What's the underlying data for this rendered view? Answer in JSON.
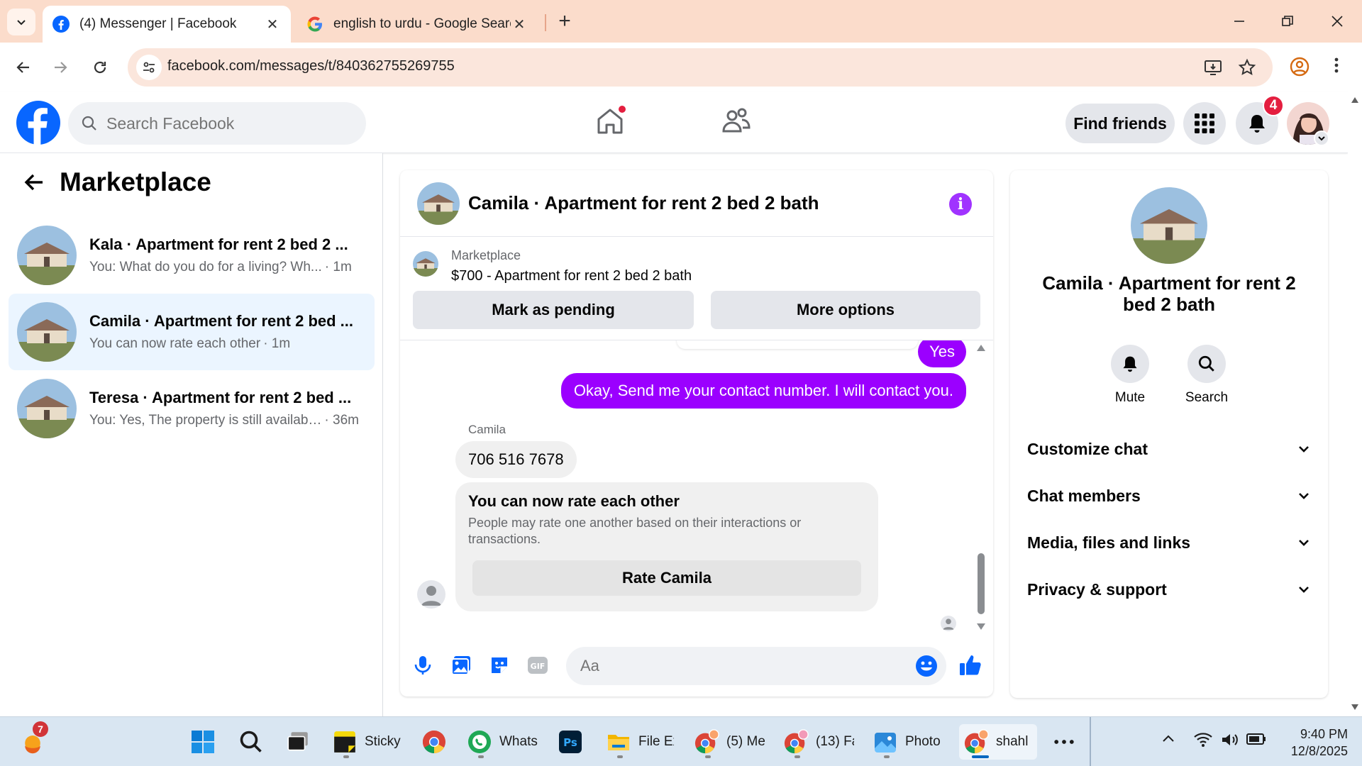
{
  "browser": {
    "tabs": [
      {
        "title": "(4) Messenger | Facebook",
        "icon": "facebook-icon",
        "active": true
      },
      {
        "title": "english to urdu - Google Search",
        "icon": "google-icon",
        "active": false
      }
    ],
    "url": "facebook.com/messages/t/840362755269755"
  },
  "header": {
    "search_placeholder": "Search Facebook",
    "find_friends": "Find friends",
    "notification_count": "4"
  },
  "sidebar": {
    "title": "Marketplace",
    "conversations": [
      {
        "name": "Kala · Apartment for rent 2 bed 2 ...",
        "preview": "You: What do you do for a living? Wh...",
        "time": "· 1m",
        "selected": false
      },
      {
        "name": "Camila · Apartment for rent 2 bed ...",
        "preview": "You can now rate each other",
        "time": "· 1m",
        "selected": true
      },
      {
        "name": "Teresa · Apartment for rent 2 bed ...",
        "preview": "You: Yes, The property is still availabl...",
        "time": "· 36m",
        "selected": false
      }
    ]
  },
  "chat": {
    "title": "Camila · Apartment for rent 2 bed 2 bath",
    "marketplace_label": "Marketplace",
    "listing": "$700 - Apartment for rent 2 bed 2 bath",
    "mark_pending": "Mark as pending",
    "more_options": "More options",
    "messages": {
      "out_yes": "Yes",
      "out_contact": "Okay, Send me your contact number. I will contact you.",
      "sender_name": "Camila",
      "in_phone": "706 516 7678"
    },
    "rate_card": {
      "title": "You can now rate each other",
      "description": "People may rate one another based on their interactions or transactions.",
      "button": "Rate Camila"
    },
    "composer_placeholder": "Aa"
  },
  "details": {
    "name": "Camila · Apartment for rent 2 bed 2 bath",
    "actions": [
      "Mute",
      "Search"
    ],
    "sections": [
      "Customize chat",
      "Chat members",
      "Media, files and links",
      "Privacy & support"
    ]
  },
  "taskbar": {
    "weather_badge": "7",
    "apps": [
      {
        "label": "Sticky",
        "icon": "sticky-notes-icon"
      },
      {
        "label": "",
        "icon": "chrome-icon"
      },
      {
        "label": "Whats",
        "icon": "whatsapp-icon"
      },
      {
        "label": "",
        "icon": "photoshop-icon"
      },
      {
        "label": "File Ex",
        "icon": "file-explorer-icon"
      },
      {
        "label": "(5) Me",
        "icon": "chrome-profile-icon"
      },
      {
        "label": "(13) Fa",
        "icon": "chrome-profile-icon"
      },
      {
        "label": "Photo",
        "icon": "photos-icon"
      },
      {
        "label": "shahl",
        "icon": "chrome-profile-icon"
      }
    ],
    "time": "9:40 PM",
    "date": "12/8/2025"
  },
  "colors": {
    "facebook_blue": "#0866ff",
    "messenger_purple": "#9b00ff",
    "tabbar_bg": "#fbdccb",
    "selected_conv": "#ebf5ff"
  }
}
